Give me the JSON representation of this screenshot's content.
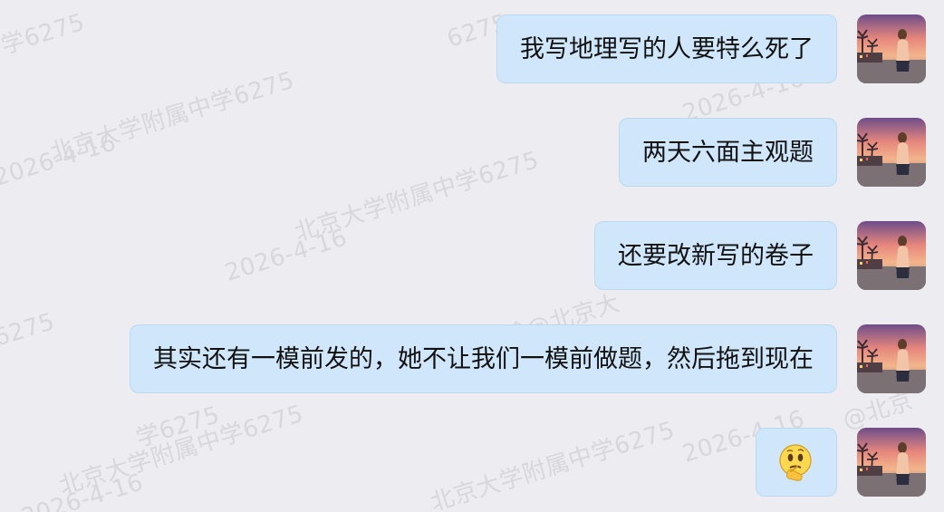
{
  "watermarks": [
    "北京大学附属中学6275",
    "北京大学附属中学6275",
    "北京大学附属中学6275",
    "北京大学附属中学6275",
    "2026-4-16",
    "2026-4-16",
    "2026-4-16",
    "2026-4-16",
    "2026-4-16",
    "6275",
    "附属中学6275",
    "学6275",
    "6275",
    "@北京",
    "春东晗@北京大"
  ],
  "messages": [
    {
      "text": "我写地理写的人要特么死了"
    },
    {
      "text": "两天六面主观题"
    },
    {
      "text": "还要改新写的卷子"
    },
    {
      "text": "其实还有一模前发的，她不让我们一模前做题，然后拖到现在"
    },
    {
      "text": "",
      "emoji": "thinking-emoji-icon"
    }
  ],
  "colors": {
    "background": "#ececf1",
    "bubble": "#cfe6fb",
    "bubble_border": "#bcd9f4",
    "text": "#111111"
  }
}
